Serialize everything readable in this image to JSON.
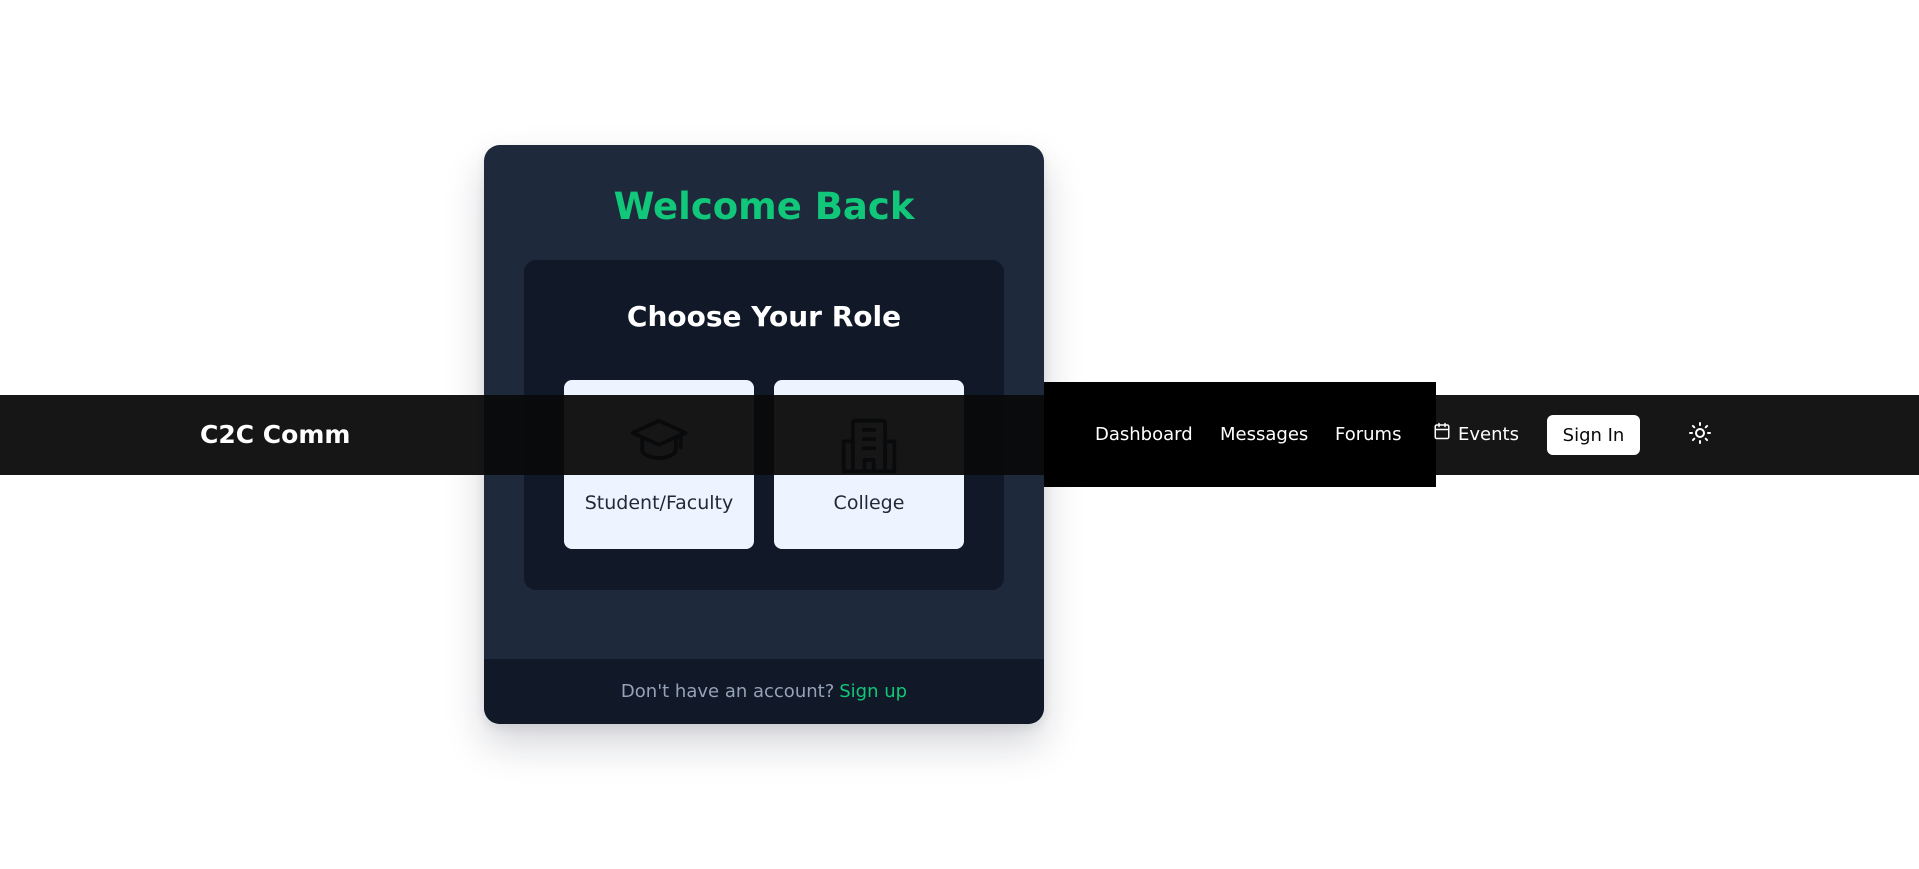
{
  "login": {
    "title": "Welcome Back",
    "role_heading": "Choose Your Role",
    "roles": [
      {
        "label": "Student/Faculty",
        "icon": "graduation-cap-icon"
      },
      {
        "label": "College",
        "icon": "building-icon"
      }
    ],
    "footer_prompt": "Don't have an account?",
    "signup_label": "Sign up"
  },
  "navbar": {
    "logo": "C2C Comm",
    "items": [
      {
        "label": "Dashboard"
      },
      {
        "label": "Messages"
      },
      {
        "label": "Forums"
      },
      {
        "label": "Events",
        "icon": "calendar-icon"
      }
    ],
    "signin_label": "Sign In",
    "theme_toggle_icon": "sun-icon"
  },
  "colors": {
    "accent": "#10c77a",
    "card_background": "#1e293b",
    "panel_background": "#111827",
    "navbar_background": "#0a0a0a",
    "role_option_background": "#eef4ff"
  }
}
